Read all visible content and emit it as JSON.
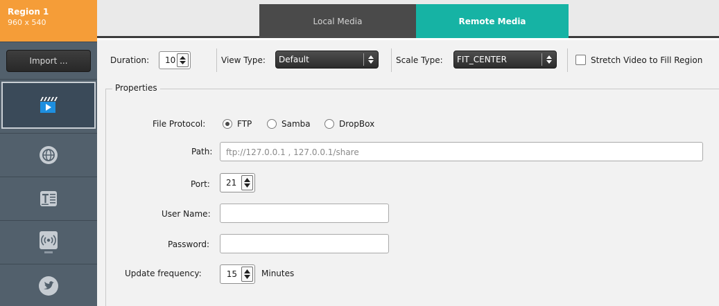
{
  "sidebar": {
    "region_title": "Region 1",
    "region_size": "960 x 540",
    "import_label": "Import ...",
    "items": [
      {
        "icon": "video-clapper-icon",
        "active": true
      },
      {
        "icon": "globe-icon",
        "active": false
      },
      {
        "icon": "text-icon",
        "active": false
      },
      {
        "icon": "broadcast-icon",
        "active": false
      },
      {
        "icon": "twitter-icon",
        "active": false
      }
    ]
  },
  "tabs": [
    {
      "label": "Local Media",
      "selected": false
    },
    {
      "label": "Remote Media",
      "selected": true
    }
  ],
  "toolbar": {
    "duration_label": "Duration:",
    "duration_value": "10",
    "view_type_label": "View Type:",
    "view_type_value": "Default",
    "scale_type_label": "Scale Type:",
    "scale_type_value": "FIT_CENTER",
    "stretch_label": "Stretch Video to Fill Region",
    "stretch_checked": false
  },
  "properties": {
    "legend": "Properties",
    "file_protocol_label": "File Protocol:",
    "protocol_options": [
      "FTP",
      "Samba",
      "DropBox"
    ],
    "protocol_selected": "FTP",
    "path_label": "Path:",
    "path_placeholder": "ftp://127.0.0.1 , 127.0.0.1/share",
    "port_label": "Port:",
    "port_value": "21",
    "username_label": "User Name:",
    "username_value": "",
    "password_label": "Password:",
    "password_value": "",
    "update_frequency_label": "Update frequency:",
    "update_frequency_value": "15",
    "update_frequency_unit": "Minutes"
  },
  "colors": {
    "region_orange": "#f59d38",
    "sidebar_bg": "#52606c",
    "tab_selected": "#16b3a4",
    "tab_unselected": "#4a4a4a"
  }
}
